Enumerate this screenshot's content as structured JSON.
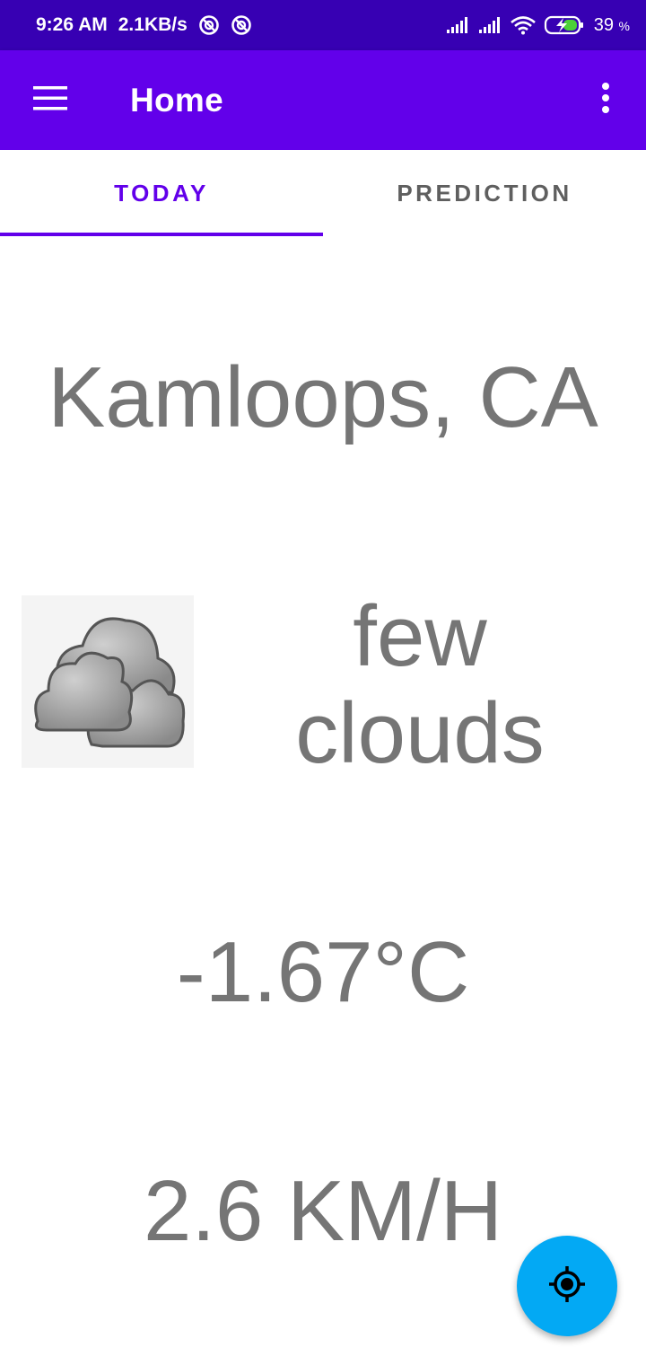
{
  "status_bar": {
    "time": "9:26 AM",
    "speed": "2.1KB/s",
    "battery_level": "39",
    "battery_unit": "%",
    "icons": [
      "vpn-icon",
      "vpn-icon",
      "signal-icon",
      "signal-icon",
      "wifi-icon",
      "battery-charging-icon"
    ]
  },
  "app_bar": {
    "title": "Home",
    "menu_icon": "menu-icon",
    "overflow_icon": "more-vert-icon",
    "color": "#6200ea"
  },
  "tabs": [
    {
      "label": "TODAY",
      "active": true
    },
    {
      "label": "PREDICTION",
      "active": false
    }
  ],
  "weather": {
    "city": "Kamloops, CA",
    "condition_line1": "few",
    "condition_line2": "clouds",
    "icon": "clouds-icon",
    "temperature": "-1.67°C",
    "wind": "2.6 KM/H"
  },
  "fab": {
    "icon": "my-location-icon",
    "color": "#03a9f4"
  }
}
